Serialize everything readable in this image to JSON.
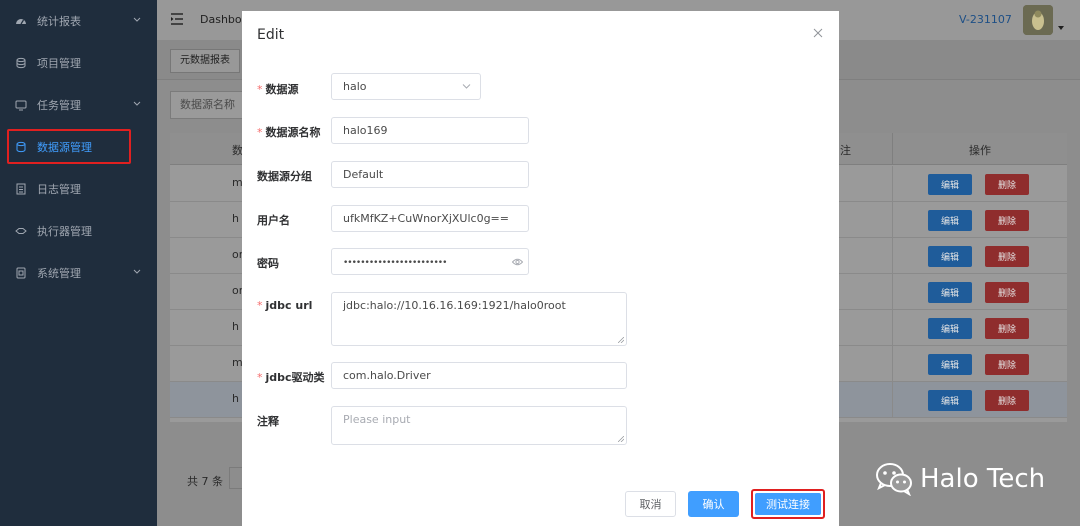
{
  "sidebar": {
    "items": [
      {
        "label": "统计报表",
        "icon": "dashboard-icon",
        "has_arrow": true
      },
      {
        "label": "项目管理",
        "icon": "database-icon",
        "has_arrow": false
      },
      {
        "label": "任务管理",
        "icon": "monitor-icon",
        "has_arrow": true
      },
      {
        "label": "数据源管理",
        "icon": "datasource-icon",
        "has_arrow": false,
        "active": true
      },
      {
        "label": "日志管理",
        "icon": "document-icon",
        "has_arrow": false
      },
      {
        "label": "执行器管理",
        "icon": "link-icon",
        "has_arrow": false
      },
      {
        "label": "系统管理",
        "icon": "settings-icon",
        "has_arrow": true
      }
    ]
  },
  "navbar": {
    "breadcrumb": "Dashboa",
    "version": "V-231107"
  },
  "tags": {
    "active": "元数据报表"
  },
  "search": {
    "placeholder": "数据源名称"
  },
  "table": {
    "header_first": "数",
    "header_note": "注",
    "header_ops": "操作",
    "row_fragments": [
      "m",
      "h",
      "or",
      "or",
      "h",
      "m",
      "h"
    ],
    "edit_label": "编辑",
    "delete_label": "删除"
  },
  "pagination": {
    "total": "共 7 条"
  },
  "dialog": {
    "title": "Edit",
    "fields": {
      "datasource": {
        "label": "数据源",
        "value": "halo",
        "required": true
      },
      "datasource_name": {
        "label": "数据源名称",
        "value": "halo169",
        "required": true
      },
      "datasource_group": {
        "label": "数据源分组",
        "value": "Default",
        "required": false
      },
      "username": {
        "label": "用户名",
        "value": "ufkMfKZ+CuWnorXjXUlc0g==",
        "required": false
      },
      "password": {
        "label": "密码",
        "value": "••••••••••••••••••••••••",
        "required": false
      },
      "jdbc_url": {
        "label": "jdbc url",
        "value": "jdbc:halo://10.16.16.169:1921/halo0root",
        "required": true
      },
      "jdbc_driver": {
        "label": "jdbc驱动类",
        "value": "com.halo.Driver",
        "required": true
      },
      "comment": {
        "label": "注释",
        "placeholder": "Please input",
        "required": false
      }
    },
    "buttons": {
      "cancel": "取消",
      "confirm": "确认",
      "test": "测试连接"
    }
  },
  "watermark": {
    "text": "Halo Tech"
  },
  "colors": {
    "sidebar_bg": "#1f2d3d",
    "primary": "#409eff",
    "danger": "#f56c6c",
    "highlight_box": "#e02020"
  }
}
